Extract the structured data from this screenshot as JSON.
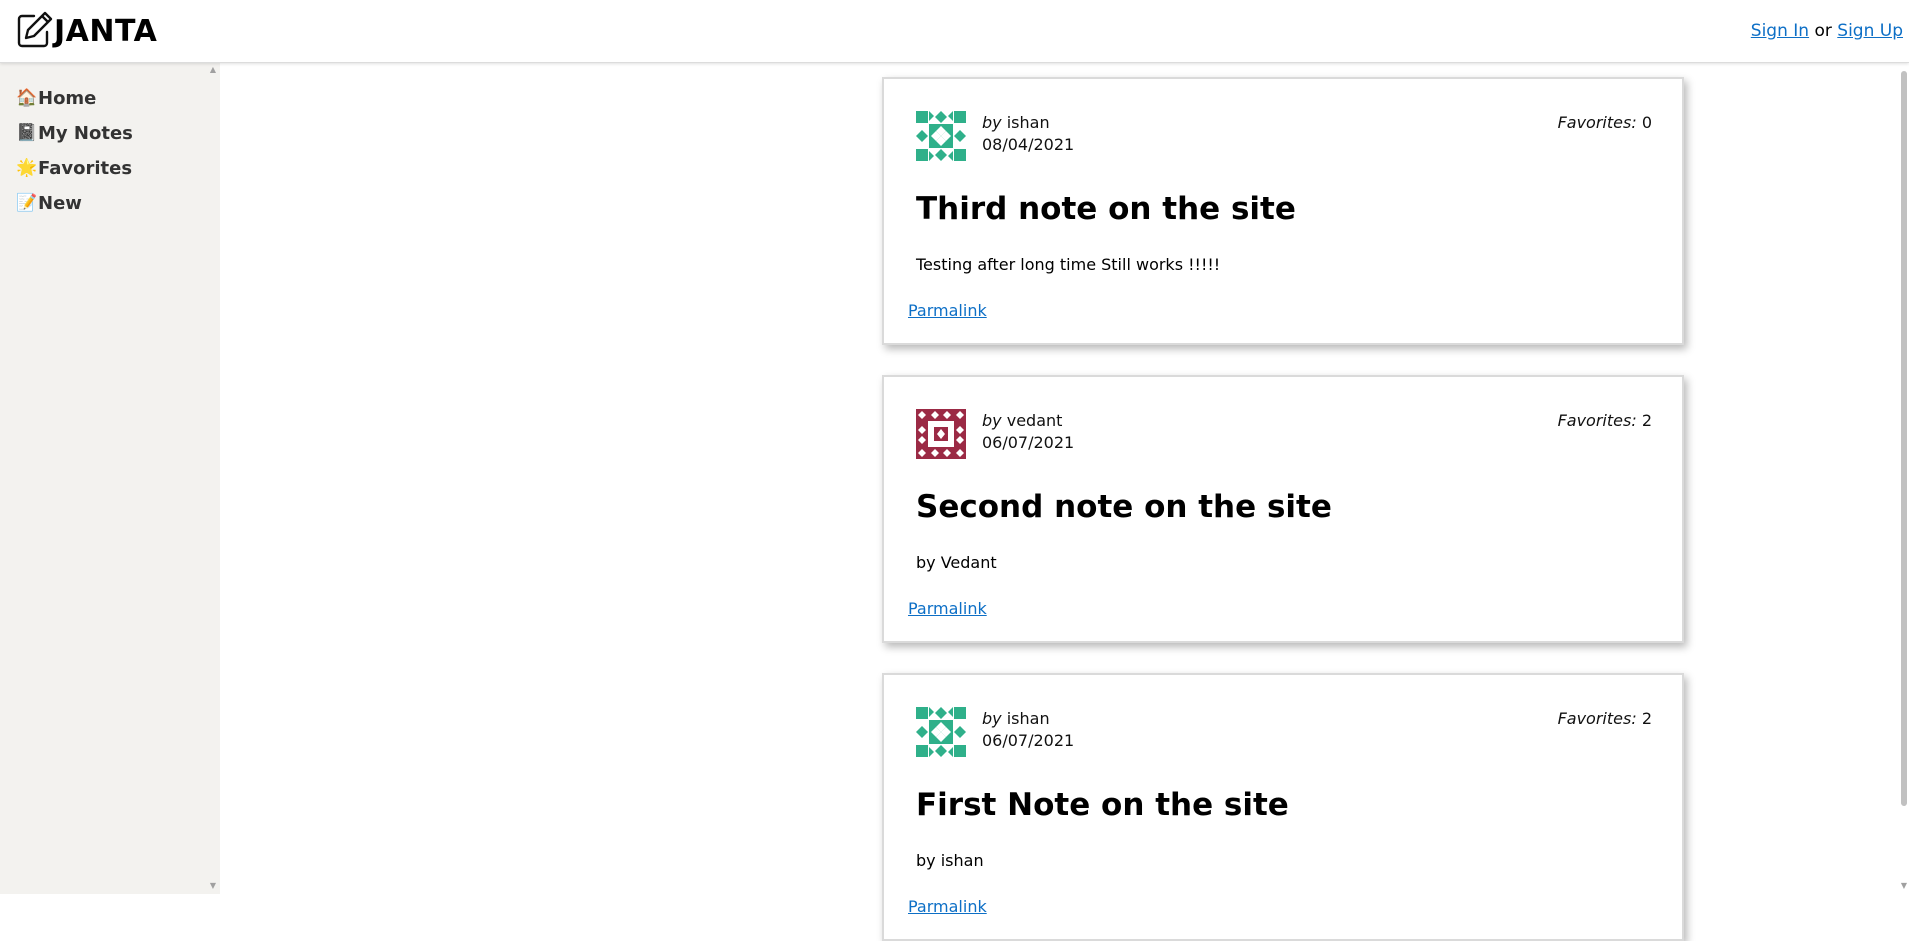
{
  "header": {
    "logo_text": "JANTA",
    "sign_in": "Sign In",
    "or_text": "or",
    "sign_up": "Sign Up"
  },
  "sidebar": {
    "items": [
      {
        "emoji": "🏠",
        "label": "Home"
      },
      {
        "emoji": "📓",
        "label": "My Notes"
      },
      {
        "emoji": "🌟",
        "label": "Favorites"
      },
      {
        "emoji": "📝",
        "label": "New"
      }
    ]
  },
  "notes": [
    {
      "by_label": "by",
      "author": "ishan",
      "date": "08/04/2021",
      "favorites_label": "Favorites:",
      "favorites": "0",
      "title": "Third note on the site",
      "content": "Testing after long time Still works !!!!!",
      "permalink": "Parmalink",
      "avatar_color": "#2fb08a"
    },
    {
      "by_label": "by",
      "author": "vedant",
      "date": "06/07/2021",
      "favorites_label": "Favorites:",
      "favorites": "2",
      "title": "Second note on the site",
      "content": "by Vedant",
      "permalink": "Parmalink",
      "avatar_color": "#9b2a45"
    },
    {
      "by_label": "by",
      "author": "ishan",
      "date": "06/07/2021",
      "favorites_label": "Favorites:",
      "favorites": "2",
      "title": "First Note on the site",
      "content": "by ishan",
      "permalink": "Parmalink",
      "avatar_color": "#2fb08a"
    }
  ],
  "colors": {
    "link": "#0d6fc6",
    "sidebar_bg": "#f3f2ef"
  }
}
